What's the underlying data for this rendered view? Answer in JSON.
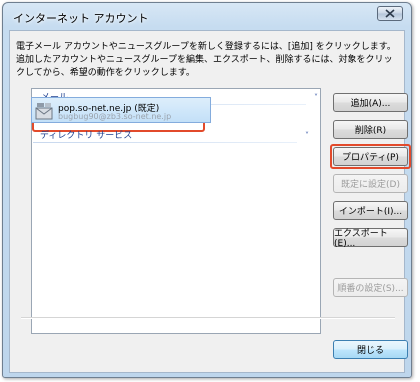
{
  "window": {
    "title": "インターネット アカウント",
    "close_icon": "close-icon"
  },
  "description": "電子メール アカウントやニュースグループを新しく登録するには、[追加] をクリックします。追加したアカウントやニュースグループを編集、エクスポート、削除するには、対象をクリックしてから、希望の動作をクリックします。",
  "list": {
    "groups": [
      {
        "label": "メール",
        "chevron": "˅"
      },
      {
        "label": "ディレクトリ サービス",
        "chevron": "˅"
      }
    ],
    "account": {
      "name": "pop.so-net.ne.jp (既定)",
      "email": "bugbug90@zb3.so-net.ne.jp",
      "icon": "mail-account-icon"
    }
  },
  "buttons": {
    "add": "追加(A)...",
    "remove": "削除(R)",
    "properties": "プロパティ(P)",
    "set_default": "既定に設定(D)",
    "import": "インポート(I)...",
    "export": "エクスポート(E)...",
    "order": "順番の設定(S)...",
    "close": "閉じる"
  },
  "colors": {
    "highlight": "#e24a2b",
    "selection": "#c3e0f8",
    "group_header": "#1e3f8f"
  }
}
